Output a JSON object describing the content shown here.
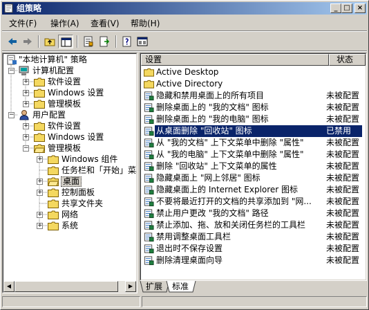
{
  "window": {
    "title": "组策略"
  },
  "title_buttons": {
    "minimize": "_",
    "maximize": "□",
    "close": "×"
  },
  "menu": [
    {
      "label": "文件(F)"
    },
    {
      "label": "操作(A)"
    },
    {
      "label": "查看(V)"
    },
    {
      "label": "帮助(H)"
    }
  ],
  "toolbar": [
    "back-arrow-icon",
    "forward-arrow-icon",
    "up-folder-icon",
    "show-tree-icon",
    "properties-icon",
    "export-list-icon",
    "help-icon",
    "console-icon"
  ],
  "tree": [
    {
      "label": "\"本地计算机\" 策略",
      "level": 0,
      "expander": "",
      "icon": "policy-icon"
    },
    {
      "label": "计算机配置",
      "level": 1,
      "expander": "−",
      "icon": "computer-icon"
    },
    {
      "label": "软件设置",
      "level": 2,
      "expander": "+",
      "icon": "folder-icon"
    },
    {
      "label": "Windows 设置",
      "level": 2,
      "expander": "+",
      "icon": "folder-icon"
    },
    {
      "label": "管理模板",
      "level": 2,
      "expander": "+",
      "icon": "folder-icon"
    },
    {
      "label": "用户配置",
      "level": 1,
      "expander": "−",
      "icon": "user-icon"
    },
    {
      "label": "软件设置",
      "level": 2,
      "expander": "+",
      "icon": "folder-icon"
    },
    {
      "label": "Windows 设置",
      "level": 2,
      "expander": "+",
      "icon": "folder-icon"
    },
    {
      "label": "管理模板",
      "level": 2,
      "expander": "−",
      "icon": "folder-icon"
    },
    {
      "label": "Windows 组件",
      "level": 3,
      "expander": "+",
      "icon": "folder-icon"
    },
    {
      "label": "任务栏和「开始」菜单",
      "level": 3,
      "expander": "",
      "icon": "folder-icon"
    },
    {
      "label": "桌面",
      "level": 3,
      "expander": "+",
      "icon": "open-folder-icon",
      "selected": true
    },
    {
      "label": "控制面板",
      "level": 3,
      "expander": "+",
      "icon": "folder-icon"
    },
    {
      "label": "共享文件夹",
      "level": 3,
      "expander": "",
      "icon": "folder-icon"
    },
    {
      "label": "网络",
      "level": 3,
      "expander": "+",
      "icon": "folder-icon"
    },
    {
      "label": "系统",
      "level": 3,
      "expander": "+",
      "icon": "folder-icon"
    }
  ],
  "list": {
    "columns": [
      "设置",
      "状态"
    ],
    "rows": [
      {
        "name": "Active Desktop",
        "state": "",
        "icon": "folder-icon"
      },
      {
        "name": "Active Directory",
        "state": "",
        "icon": "folder-icon"
      },
      {
        "name": "隐藏和禁用桌面上的所有项目",
        "state": "未被配置",
        "icon": "policy-setting-icon"
      },
      {
        "name": "删除桌面上的 \"我的文档\" 图标",
        "state": "未被配置",
        "icon": "policy-setting-icon"
      },
      {
        "name": "删除桌面上的 \"我的电脑\" 图标",
        "state": "未被配置",
        "icon": "policy-setting-icon"
      },
      {
        "name": "从桌面删除 \"回收站\" 图标",
        "state": "已禁用",
        "icon": "policy-setting-icon",
        "selected": true
      },
      {
        "name": "从 \"我的文档\" 上下文菜单中删除 \"属性\"",
        "state": "未被配置",
        "icon": "policy-setting-icon"
      },
      {
        "name": "从 \"我的电脑\" 上下文菜单中删除 \"属性\"",
        "state": "未被配置",
        "icon": "policy-setting-icon"
      },
      {
        "name": "删除 \"回收站\" 上下文菜单的属性",
        "state": "未被配置",
        "icon": "policy-setting-icon"
      },
      {
        "name": "隐藏桌面上 \"网上邻居\" 图标",
        "state": "未被配置",
        "icon": "policy-setting-icon"
      },
      {
        "name": "隐藏桌面上的 Internet Explorer 图标",
        "state": "未被配置",
        "icon": "policy-setting-icon"
      },
      {
        "name": "不要将最近打开的文档的共享添加到 \"网...",
        "state": "未被配置",
        "icon": "policy-setting-icon"
      },
      {
        "name": "禁止用户更改 \"我的文档\" 路径",
        "state": "未被配置",
        "icon": "policy-setting-icon"
      },
      {
        "name": "禁止添加、拖、放和关闭任务栏的工具栏",
        "state": "未被配置",
        "icon": "policy-setting-icon"
      },
      {
        "name": "禁用调整桌面工具栏",
        "state": "未被配置",
        "icon": "policy-setting-icon"
      },
      {
        "name": "退出时不保存设置",
        "state": "未被配置",
        "icon": "policy-setting-icon"
      },
      {
        "name": "删除清理桌面向导",
        "state": "未被配置",
        "icon": "policy-setting-icon"
      }
    ]
  },
  "tabs": [
    {
      "label": "扩展"
    },
    {
      "label": "标准",
      "active": true
    }
  ]
}
